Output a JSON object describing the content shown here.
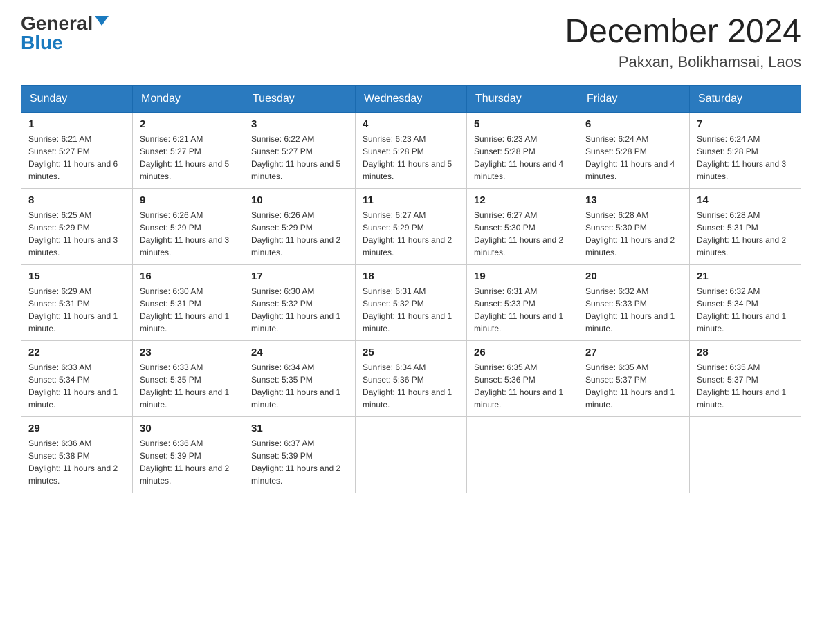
{
  "header": {
    "logo": {
      "general": "General",
      "blue": "Blue"
    },
    "title": "December 2024",
    "location": "Pakxan, Bolikhamsai, Laos"
  },
  "days_of_week": [
    "Sunday",
    "Monday",
    "Tuesday",
    "Wednesday",
    "Thursday",
    "Friday",
    "Saturday"
  ],
  "weeks": [
    [
      {
        "day": "1",
        "sunrise": "6:21 AM",
        "sunset": "5:27 PM",
        "daylight": "11 hours and 6 minutes."
      },
      {
        "day": "2",
        "sunrise": "6:21 AM",
        "sunset": "5:27 PM",
        "daylight": "11 hours and 5 minutes."
      },
      {
        "day": "3",
        "sunrise": "6:22 AM",
        "sunset": "5:27 PM",
        "daylight": "11 hours and 5 minutes."
      },
      {
        "day": "4",
        "sunrise": "6:23 AM",
        "sunset": "5:28 PM",
        "daylight": "11 hours and 5 minutes."
      },
      {
        "day": "5",
        "sunrise": "6:23 AM",
        "sunset": "5:28 PM",
        "daylight": "11 hours and 4 minutes."
      },
      {
        "day": "6",
        "sunrise": "6:24 AM",
        "sunset": "5:28 PM",
        "daylight": "11 hours and 4 minutes."
      },
      {
        "day": "7",
        "sunrise": "6:24 AM",
        "sunset": "5:28 PM",
        "daylight": "11 hours and 3 minutes."
      }
    ],
    [
      {
        "day": "8",
        "sunrise": "6:25 AM",
        "sunset": "5:29 PM",
        "daylight": "11 hours and 3 minutes."
      },
      {
        "day": "9",
        "sunrise": "6:26 AM",
        "sunset": "5:29 PM",
        "daylight": "11 hours and 3 minutes."
      },
      {
        "day": "10",
        "sunrise": "6:26 AM",
        "sunset": "5:29 PM",
        "daylight": "11 hours and 2 minutes."
      },
      {
        "day": "11",
        "sunrise": "6:27 AM",
        "sunset": "5:29 PM",
        "daylight": "11 hours and 2 minutes."
      },
      {
        "day": "12",
        "sunrise": "6:27 AM",
        "sunset": "5:30 PM",
        "daylight": "11 hours and 2 minutes."
      },
      {
        "day": "13",
        "sunrise": "6:28 AM",
        "sunset": "5:30 PM",
        "daylight": "11 hours and 2 minutes."
      },
      {
        "day": "14",
        "sunrise": "6:28 AM",
        "sunset": "5:31 PM",
        "daylight": "11 hours and 2 minutes."
      }
    ],
    [
      {
        "day": "15",
        "sunrise": "6:29 AM",
        "sunset": "5:31 PM",
        "daylight": "11 hours and 1 minute."
      },
      {
        "day": "16",
        "sunrise": "6:30 AM",
        "sunset": "5:31 PM",
        "daylight": "11 hours and 1 minute."
      },
      {
        "day": "17",
        "sunrise": "6:30 AM",
        "sunset": "5:32 PM",
        "daylight": "11 hours and 1 minute."
      },
      {
        "day": "18",
        "sunrise": "6:31 AM",
        "sunset": "5:32 PM",
        "daylight": "11 hours and 1 minute."
      },
      {
        "day": "19",
        "sunrise": "6:31 AM",
        "sunset": "5:33 PM",
        "daylight": "11 hours and 1 minute."
      },
      {
        "day": "20",
        "sunrise": "6:32 AM",
        "sunset": "5:33 PM",
        "daylight": "11 hours and 1 minute."
      },
      {
        "day": "21",
        "sunrise": "6:32 AM",
        "sunset": "5:34 PM",
        "daylight": "11 hours and 1 minute."
      }
    ],
    [
      {
        "day": "22",
        "sunrise": "6:33 AM",
        "sunset": "5:34 PM",
        "daylight": "11 hours and 1 minute."
      },
      {
        "day": "23",
        "sunrise": "6:33 AM",
        "sunset": "5:35 PM",
        "daylight": "11 hours and 1 minute."
      },
      {
        "day": "24",
        "sunrise": "6:34 AM",
        "sunset": "5:35 PM",
        "daylight": "11 hours and 1 minute."
      },
      {
        "day": "25",
        "sunrise": "6:34 AM",
        "sunset": "5:36 PM",
        "daylight": "11 hours and 1 minute."
      },
      {
        "day": "26",
        "sunrise": "6:35 AM",
        "sunset": "5:36 PM",
        "daylight": "11 hours and 1 minute."
      },
      {
        "day": "27",
        "sunrise": "6:35 AM",
        "sunset": "5:37 PM",
        "daylight": "11 hours and 1 minute."
      },
      {
        "day": "28",
        "sunrise": "6:35 AM",
        "sunset": "5:37 PM",
        "daylight": "11 hours and 1 minute."
      }
    ],
    [
      {
        "day": "29",
        "sunrise": "6:36 AM",
        "sunset": "5:38 PM",
        "daylight": "11 hours and 2 minutes."
      },
      {
        "day": "30",
        "sunrise": "6:36 AM",
        "sunset": "5:39 PM",
        "daylight": "11 hours and 2 minutes."
      },
      {
        "day": "31",
        "sunrise": "6:37 AM",
        "sunset": "5:39 PM",
        "daylight": "11 hours and 2 minutes."
      },
      null,
      null,
      null,
      null
    ]
  ]
}
